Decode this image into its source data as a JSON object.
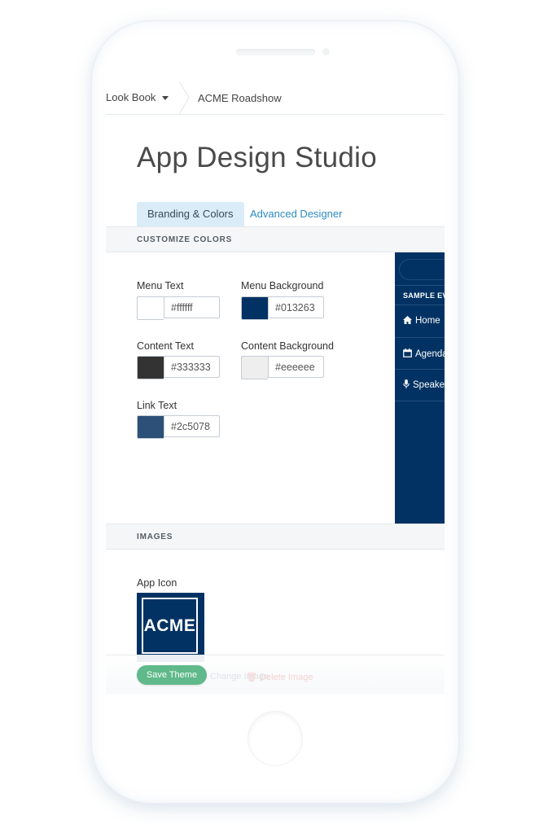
{
  "breadcrumb": {
    "item1": "Look Book",
    "item2": "ACME Roadshow"
  },
  "page": {
    "title": "App Design Studio"
  },
  "tabs": [
    {
      "label": "Branding & Colors",
      "active": true
    },
    {
      "label": "Advanced Designer",
      "active": false
    }
  ],
  "sections": {
    "colors": "CUSTOMIZE COLORS",
    "images": "IMAGES"
  },
  "colors": {
    "menu_text": {
      "label": "Menu Text",
      "value": "#ffffff"
    },
    "menu_background": {
      "label": "Menu Background",
      "value": "#013263"
    },
    "content_text": {
      "label": "Content Text",
      "value": "#333333"
    },
    "content_background": {
      "label": "Content Background",
      "value": "#eeeeee"
    },
    "link_text": {
      "label": "Link Text",
      "value": "#2c5078"
    }
  },
  "preview": {
    "event_label": "SAMPLE EVENT",
    "items": [
      {
        "label": "Home",
        "icon": "home-icon"
      },
      {
        "label": "Agenda",
        "icon": "calendar-icon"
      },
      {
        "label": "Speakers",
        "icon": "microphone-icon"
      }
    ]
  },
  "images": {
    "app_icon_label": "App Icon",
    "app_icon_text": "ACME"
  },
  "footer": {
    "save_label": "Save Theme",
    "change_label": "Change Image",
    "delete_label": "Delete Image"
  }
}
